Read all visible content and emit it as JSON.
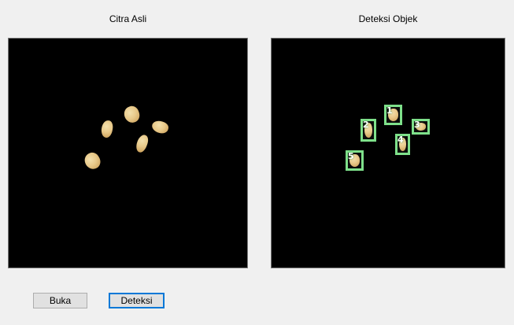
{
  "labels": {
    "original_image": "Citra Asli",
    "object_detection": "Deteksi Objek"
  },
  "detections": [
    "1",
    "2",
    "3",
    "4",
    "5"
  ],
  "buttons": {
    "open": "Buka",
    "detect": "Deteksi"
  },
  "colors": {
    "background": "#f0f0f0",
    "image_background": "#000000",
    "detection_box": "#7ee08a",
    "focused_button_border": "#0078d7"
  }
}
